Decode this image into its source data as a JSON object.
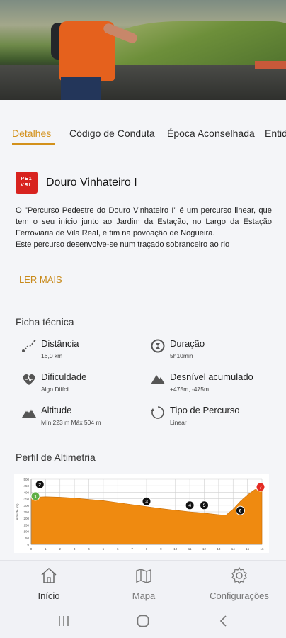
{
  "tabs": [
    "Detalhes",
    "Código de Conduta",
    "Época Aconselhada",
    "Entid"
  ],
  "route": {
    "logo_text_top": "PE1",
    "logo_text_bottom": "VRL",
    "title": "Douro Vinhateiro I"
  },
  "description": [
    "O \"Percurso Pedestre do Douro Vinhateiro I\" é um percurso linear, que tem o seu início junto ao Jardim da Estação, no Largo da Estação Ferroviária de Vila Real, e fim na povoação de Nogueira.",
    "Este percurso desenvolve-se num traçado sobranceiro ao rio"
  ],
  "read_more": "LER MAIS",
  "tech_sheet": {
    "title": "Ficha técnica",
    "items": [
      {
        "icon": "distance-icon",
        "label": "Distância",
        "value": "16,0 km"
      },
      {
        "icon": "duration-icon",
        "label": "Duração",
        "value": "5h10min"
      },
      {
        "icon": "difficulty-icon",
        "label": "Dificuldade",
        "value": "Algo Difícil"
      },
      {
        "icon": "elevation-gain-icon",
        "label": "Desnível acumulado",
        "value": "+475m, -475m"
      },
      {
        "icon": "altitude-icon",
        "label": "Altitude",
        "value": "Mín 223 m   Máx 504 m"
      },
      {
        "icon": "route-type-icon",
        "label": "Tipo de Percurso",
        "value": "Linear"
      }
    ]
  },
  "profile": {
    "title": "Perfil de Altimetria"
  },
  "chart_data": {
    "type": "area",
    "ylabel": "Altitude (m)",
    "ylim": [
      0,
      500
    ],
    "xlim": [
      0,
      16
    ],
    "yticks": [
      0,
      50,
      100,
      150,
      200,
      250,
      300,
      350,
      400,
      450,
      500
    ],
    "xticks": [
      0,
      1,
      2,
      3,
      4,
      5,
      6,
      7,
      8,
      9,
      10,
      11,
      12,
      13,
      14,
      15,
      16
    ],
    "x": [
      0,
      1,
      2,
      3,
      4,
      5,
      6,
      7,
      8,
      9,
      10,
      11,
      12,
      13,
      13.5,
      14,
      14.5,
      15,
      15.5,
      16
    ],
    "y": [
      360,
      365,
      362,
      355,
      345,
      335,
      320,
      305,
      290,
      275,
      262,
      250,
      240,
      228,
      224,
      270,
      330,
      380,
      420,
      440
    ],
    "color": "#ef8a10",
    "markers": [
      {
        "label": "1",
        "x": 0,
        "y": 370,
        "color": "#5fae45"
      },
      {
        "label": "2",
        "x": 0.6,
        "y": 460,
        "color": "#111111"
      },
      {
        "label": "3",
        "x": 8.0,
        "y": 330,
        "color": "#111111"
      },
      {
        "label": "4",
        "x": 11.0,
        "y": 300,
        "color": "#111111"
      },
      {
        "label": "5",
        "x": 12.0,
        "y": 300,
        "color": "#111111"
      },
      {
        "label": "6",
        "x": 14.5,
        "y": 260,
        "color": "#111111"
      },
      {
        "label": "7",
        "x": 16,
        "y": 440,
        "color": "#e42b23"
      }
    ]
  },
  "bottom_nav": [
    {
      "icon": "home-icon",
      "label": "Início"
    },
    {
      "icon": "map-icon",
      "label": "Mapa"
    },
    {
      "icon": "settings-icon",
      "label": "Configurações"
    }
  ],
  "colors": {
    "accent": "#d3911b",
    "logo_red": "#d8231f"
  }
}
